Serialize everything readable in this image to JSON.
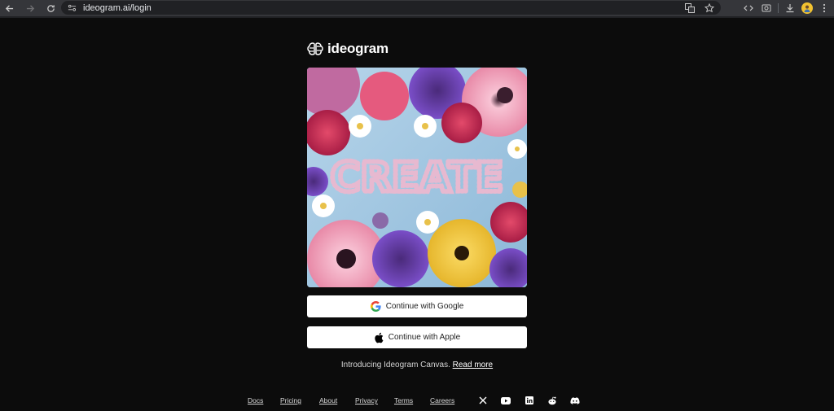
{
  "browser": {
    "url": "ideogram.ai/login",
    "back_icon": "back-arrow-icon",
    "forward_icon": "forward-arrow-icon",
    "reload_icon": "reload-icon"
  },
  "logo": {
    "text": "ideogram"
  },
  "hero": {
    "word": "CREATE"
  },
  "buttons": {
    "google": "Continue with Google",
    "apple": "Continue with Apple"
  },
  "intro": {
    "text": "Introducing Ideogram Canvas.",
    "link": "Read more"
  },
  "footer": {
    "links": [
      "Docs",
      "Pricing",
      "About",
      "Privacy",
      "Terms",
      "Careers"
    ],
    "social": [
      "x-icon",
      "youtube-icon",
      "linkedin-icon",
      "reddit-icon",
      "discord-icon"
    ]
  },
  "colors": {
    "background": "#0c0c0c",
    "button": "#ffffff",
    "chrome": "#35363a"
  }
}
